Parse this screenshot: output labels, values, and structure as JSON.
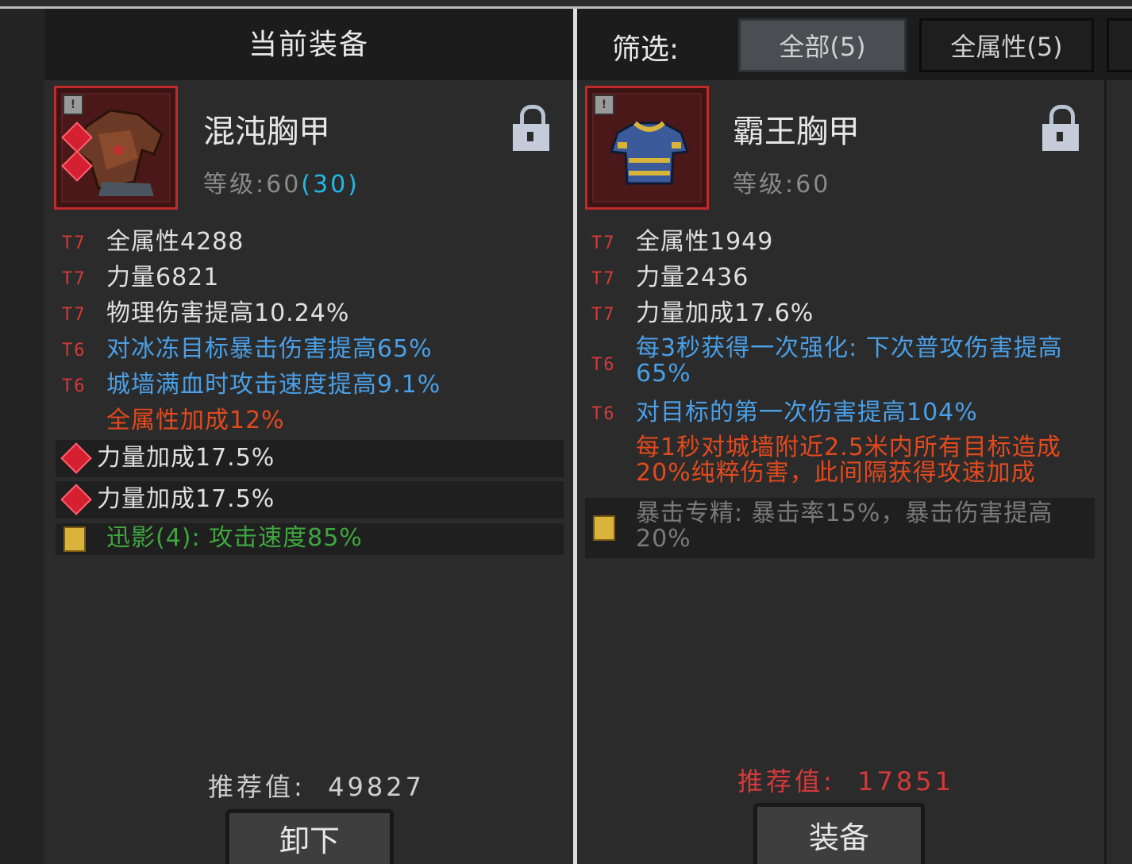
{
  "current_panel": {
    "title": "当前装备",
    "item": {
      "name": "混沌胸甲",
      "level_label": "等级:",
      "level": "60",
      "level_extra": "(30)"
    },
    "stats": [
      {
        "tier": "T7",
        "text": "全属性4288",
        "color": "white"
      },
      {
        "tier": "T7",
        "text": "力量6821",
        "color": "white"
      },
      {
        "tier": "T7",
        "text": "物理伤害提高10.24%",
        "color": "white"
      },
      {
        "tier": "T6",
        "text": "对冰冻目标暴击伤害提高65%",
        "color": "blue"
      },
      {
        "tier": "T6",
        "text": "城墙满血时攻击速度提高9.1%",
        "color": "blue"
      },
      {
        "tier": "",
        "text": "全属性加成12%",
        "color": "orange"
      }
    ],
    "gems": [
      "力量加成17.5%",
      "力量加成17.5%"
    ],
    "set_bonus": "迅影(4): 攻击速度85%",
    "score_label": "推荐值:",
    "score_value": "49827",
    "action_button": "卸下"
  },
  "compare_panel": {
    "filter_label": "筛选:",
    "filter_tabs": [
      {
        "label": "全部(5)",
        "active": true
      },
      {
        "label": "全属性(5)",
        "active": false
      }
    ],
    "item": {
      "name": "霸王胸甲",
      "level_label": "等级:",
      "level": "60"
    },
    "stats": [
      {
        "tier": "T7",
        "text": "全属性1949",
        "color": "white"
      },
      {
        "tier": "T7",
        "text": "力量2436",
        "color": "white"
      },
      {
        "tier": "T7",
        "text": "力量加成17.6%",
        "color": "white"
      },
      {
        "tier": "T6",
        "text": "每3秒获得一次强化: 下次普攻伤害提高65%",
        "color": "blue"
      },
      {
        "tier": "T6",
        "text": "对目标的第一次伤害提高104%",
        "color": "blue"
      },
      {
        "tier": "",
        "text": "每1秒对城墙附近2.5米内所有目标造成20%纯粹伤害，此间隔获得攻速加成",
        "color": "orange"
      }
    ],
    "set_bonus": "暴击专精: 暴击率15%，暴击伤害提高20%",
    "score_label": "推荐值:",
    "score_value": "17851",
    "action_button": "装备"
  },
  "colors": {
    "panel_bg": "#2b2b2b",
    "header_bg": "#1c1c1c",
    "tier_red": "#d43a3a",
    "stat_white": "#e0e0e0",
    "stat_blue": "#4a9fe6",
    "stat_orange": "#e24a1e",
    "set_green": "#3fa63f",
    "level_cyan": "#22b8e8",
    "score_red": "#d43a3a",
    "item_frame_red": "#c12a2a"
  }
}
